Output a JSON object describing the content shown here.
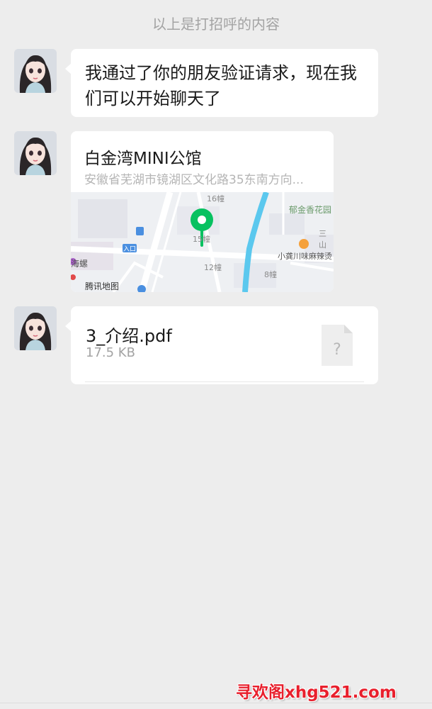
{
  "chat": {
    "system_tip": "以上是打招呼的内容",
    "messages": [
      {
        "type": "text",
        "text": "我通过了你的朋友验证请求，现在我们可以开始聊天了"
      },
      {
        "type": "location",
        "name": "白金湾MINI公馆",
        "address": "安徽省芜湖市镜湖区文化路35东南方向...",
        "map_labels": {
          "building_16": "16幢",
          "building_15": "15幢",
          "building_12": "12幢",
          "building_8": "8幢",
          "garden": "郁金香花园",
          "restaurant": "小龚川味麻辣烫",
          "entrance": "入口",
          "landmark_left": "海螺",
          "corner_three": "三山",
          "provider": "腾讯地图"
        }
      },
      {
        "type": "file",
        "file_name": "3_介绍.pdf",
        "file_size": "17.5 KB",
        "icon": "unknown-file-icon"
      }
    ]
  },
  "watermark": "寻欢阁xhg521.com",
  "colors": {
    "background": "#ededed",
    "bubble": "#ffffff",
    "pin": "#07c160",
    "river": "#5bc8ee",
    "watermark": "#e8202d"
  }
}
